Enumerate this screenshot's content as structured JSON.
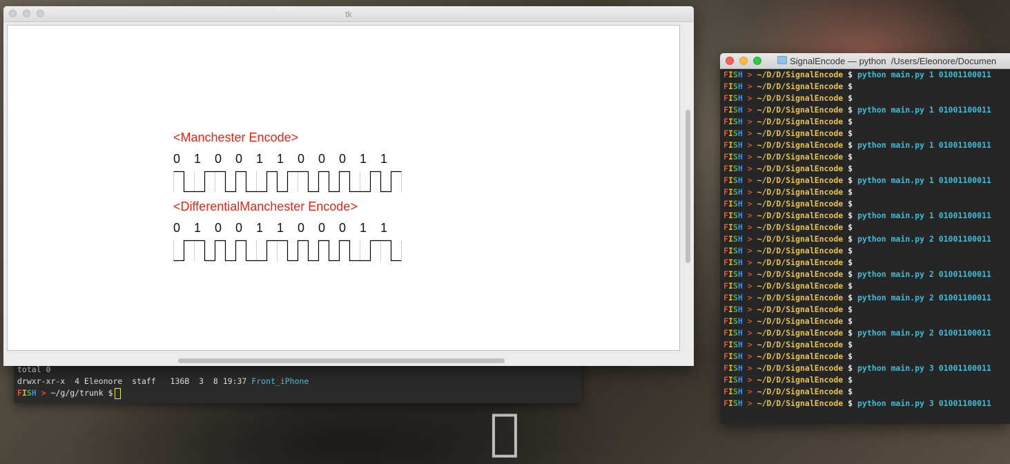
{
  "desktop": {
    "logo_icon": "apple-logo-icon"
  },
  "back_terminal": {
    "lines": [
      "total 0",
      "drwxr-xr-x  4 Eleonore  staff   136B  3  8 19:37"
    ],
    "link_text": "Front_iPhone",
    "prompt": {
      "fish": [
        "F",
        "I",
        "S",
        "H"
      ],
      "arrow": ">",
      "path": "~/g/g/trunk",
      "symbol": "$"
    }
  },
  "tk_window": {
    "title": "tk",
    "manchester": {
      "title": "<Manchester Encode>",
      "bits": [
        "0",
        "1",
        "0",
        "0",
        "1",
        "1",
        "0",
        "0",
        "0",
        "1",
        "1"
      ]
    },
    "differential": {
      "title": "<DifferentialManchester Encode>",
      "bits": [
        "0",
        "1",
        "0",
        "0",
        "1",
        "1",
        "0",
        "0",
        "0",
        "1",
        "1"
      ]
    }
  },
  "front_terminal": {
    "title": "SignalEncode — python  /Users/Eleonore/Documen",
    "folder_icon": "folder-icon",
    "prompt": {
      "fish": [
        "F",
        "I",
        "S",
        "H"
      ],
      "arrow": ">",
      "path": "~/D/D/SignalEncode",
      "symbol": "$"
    },
    "commands": [
      "python main.py 1 01001100011",
      "",
      "",
      "python main.py 1 01001100011",
      "",
      "",
      "python main.py 1 01001100011",
      "",
      "",
      "python main.py 1 01001100011",
      "",
      "",
      "python main.py 1 01001100011",
      "",
      "python main.py 2 01001100011",
      "",
      "",
      "python main.py 2 01001100011",
      "",
      "python main.py 2 01001100011",
      "",
      "",
      "python main.py 2 01001100011",
      "",
      "",
      "python main.py 3 01001100011",
      "",
      "",
      "python main.py 3 01001100011"
    ]
  },
  "colors": {
    "encode_title": "#ee2211",
    "terminal_bg": "#262626",
    "command": "#3dbcd7",
    "path": "#e7c34c",
    "fish_f": "#e4532b",
    "fish_i": "#e2b82e",
    "fish_s": "#4fb347",
    "fish_h": "#3a8ee6"
  }
}
